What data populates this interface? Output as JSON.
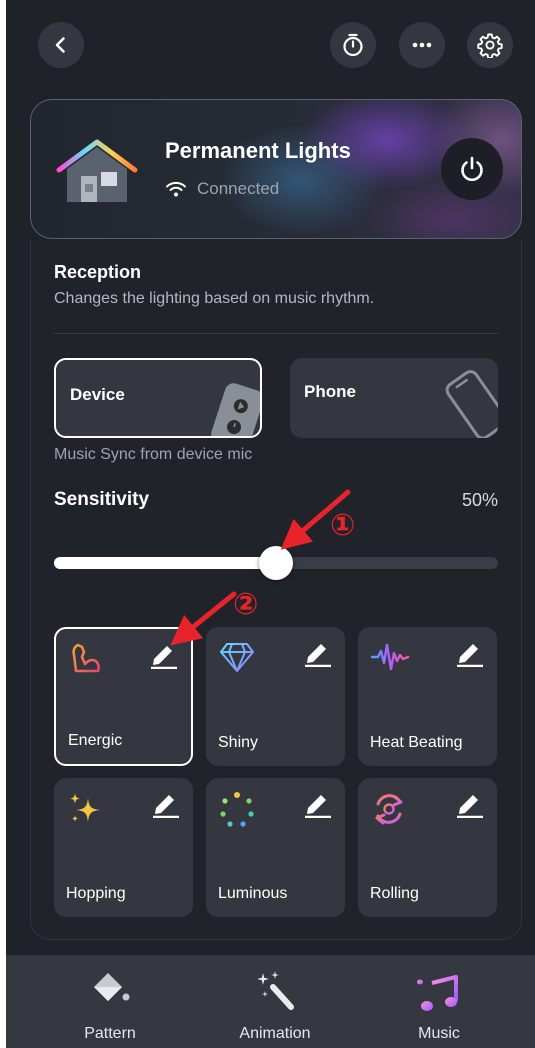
{
  "header": {
    "back_icon": "chevron-left-icon",
    "actions": [
      "timer-icon",
      "more-icon",
      "settings-gear-icon"
    ]
  },
  "device": {
    "name": "Permanent Lights",
    "status": "Connected"
  },
  "reception": {
    "title": "Reception",
    "description": "Changes the lighting based on music rhythm.",
    "sources": [
      {
        "label": "Device",
        "selected": true
      },
      {
        "label": "Phone",
        "selected": false
      }
    ],
    "source_note": "Music Sync from device mic"
  },
  "sensitivity": {
    "label": "Sensitivity",
    "value_text": "50%",
    "value": 0.5
  },
  "modes": [
    {
      "label": "Energic",
      "icon": "flexed-arm-icon",
      "selected": true
    },
    {
      "label": "Shiny",
      "icon": "diamond-icon",
      "selected": false
    },
    {
      "label": "Heat Beating",
      "icon": "waveform-icon",
      "selected": false
    },
    {
      "label": "Hopping",
      "icon": "sparkles-icon",
      "selected": false
    },
    {
      "label": "Luminous",
      "icon": "dots-circle-icon",
      "selected": false
    },
    {
      "label": "Rolling",
      "icon": "rotate-arrows-icon",
      "selected": false
    }
  ],
  "annotations": {
    "first": "①",
    "second": "②",
    "color": "#e8242a"
  },
  "bottom_nav": [
    {
      "label": "Pattern",
      "icon": "paint-bucket-icon"
    },
    {
      "label": "Animation",
      "icon": "magic-wand-icon"
    },
    {
      "label": "Music",
      "icon": "music-notes-icon"
    }
  ]
}
